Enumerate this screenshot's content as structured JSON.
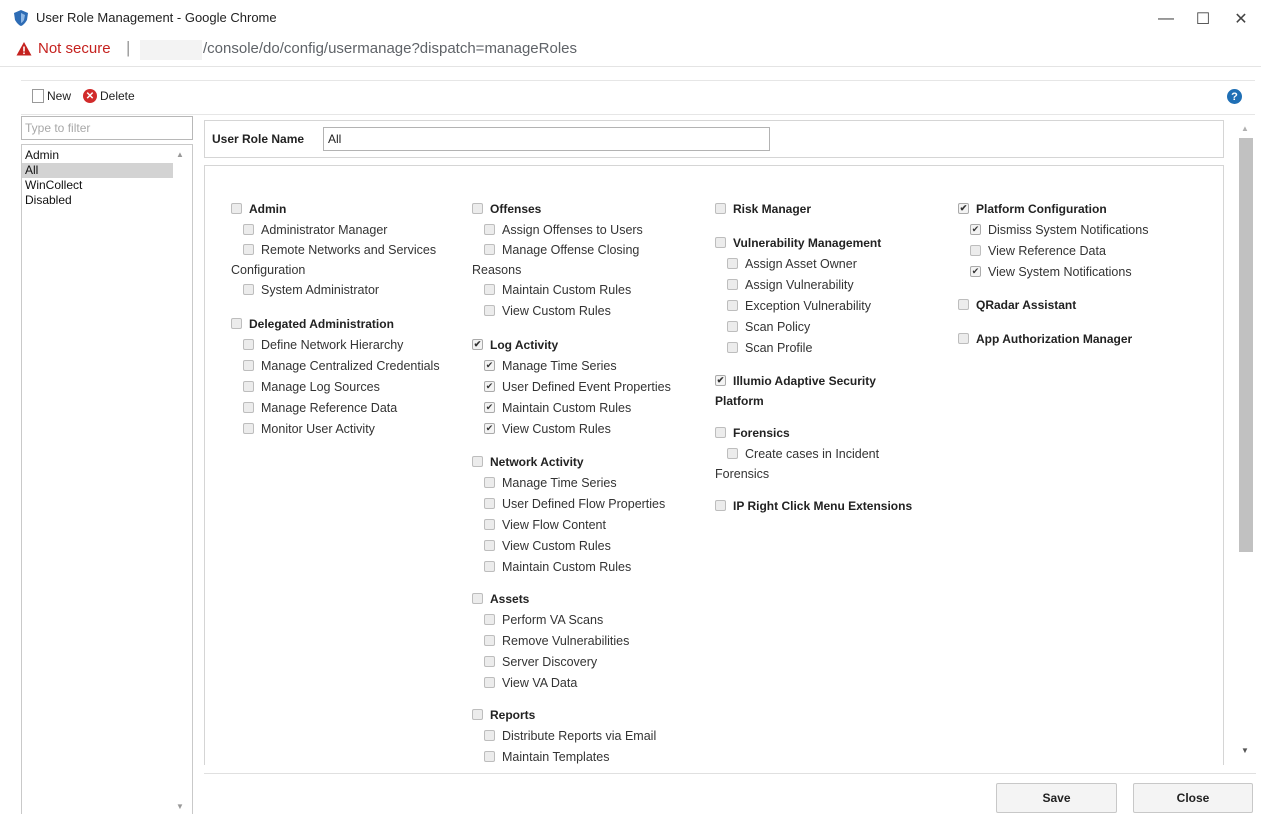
{
  "window": {
    "title": "User Role Management - Google Chrome",
    "minimize": "—",
    "maximize": "☐",
    "close": "✕"
  },
  "address": {
    "security": "Not secure",
    "separator": "|",
    "url": "/console/do/config/usermanage?dispatch=manageRoles"
  },
  "toolbar": {
    "new_label": "New",
    "delete_label": "Delete",
    "help": "?"
  },
  "filter": {
    "placeholder": "Type to filter"
  },
  "roles": {
    "items": [
      {
        "label": "Admin"
      },
      {
        "label": "All"
      },
      {
        "label": "WinCollect"
      },
      {
        "label": "Disabled"
      }
    ]
  },
  "role_name": {
    "label": "User Role Name",
    "value": "All"
  },
  "permissions": {
    "admin": {
      "title": "Admin",
      "items": [
        {
          "label": "Administrator Manager"
        },
        {
          "label": "Remote Networks and Services",
          "label2": "Configuration"
        },
        {
          "label": "System Administrator"
        }
      ]
    },
    "delegated": {
      "title": "Delegated Administration",
      "items": [
        {
          "label": "Define Network Hierarchy"
        },
        {
          "label": "Manage Centralized Credentials"
        },
        {
          "label": "Manage Log Sources"
        },
        {
          "label": "Manage Reference Data"
        },
        {
          "label": "Monitor User Activity"
        }
      ]
    },
    "offenses": {
      "title": "Offenses",
      "items": [
        {
          "label": "Assign Offenses to Users"
        },
        {
          "label": "Manage Offense Closing",
          "label2": "Reasons"
        },
        {
          "label": "Maintain Custom Rules"
        },
        {
          "label": "View Custom Rules"
        }
      ]
    },
    "log_activity": {
      "title": "Log Activity",
      "items": [
        {
          "label": "Manage Time Series"
        },
        {
          "label": "User Defined Event Properties"
        },
        {
          "label": "Maintain Custom Rules"
        },
        {
          "label": "View Custom Rules"
        }
      ]
    },
    "network_activity": {
      "title": "Network Activity",
      "items": [
        {
          "label": "Manage Time Series"
        },
        {
          "label": "User Defined Flow Properties"
        },
        {
          "label": "View Flow Content"
        },
        {
          "label": "View Custom Rules"
        },
        {
          "label": "Maintain Custom Rules"
        }
      ]
    },
    "assets": {
      "title": "Assets",
      "items": [
        {
          "label": "Perform VA Scans"
        },
        {
          "label": "Remove Vulnerabilities"
        },
        {
          "label": "Server Discovery"
        },
        {
          "label": "View VA Data"
        }
      ]
    },
    "reports": {
      "title": "Reports",
      "items": [
        {
          "label": "Distribute Reports via Email"
        },
        {
          "label": "Maintain Templates"
        }
      ]
    },
    "risk_manager": {
      "title": "Risk Manager"
    },
    "vulnerability": {
      "title": "Vulnerability Management",
      "items": [
        {
          "label": "Assign Asset Owner"
        },
        {
          "label": "Assign Vulnerability"
        },
        {
          "label": "Exception Vulnerability"
        },
        {
          "label": "Scan Policy"
        },
        {
          "label": "Scan Profile"
        }
      ]
    },
    "illumio": {
      "title": "Illumio Adaptive Security",
      "title2": "Platform"
    },
    "forensics": {
      "title": "Forensics",
      "items": [
        {
          "label": "Create cases in Incident",
          "label2": "Forensics"
        }
      ]
    },
    "ip_right_click": {
      "title": "IP Right Click Menu Extensions"
    },
    "platform_config": {
      "title": "Platform Configuration",
      "items": [
        {
          "label": "Dismiss System Notifications"
        },
        {
          "label": "View Reference Data"
        },
        {
          "label": "View System Notifications"
        }
      ]
    },
    "qradar_assistant": {
      "title": "QRadar Assistant"
    },
    "app_authorization": {
      "title": "App Authorization Manager"
    },
    "check_mark": "✔"
  },
  "footer": {
    "save_label": "Save",
    "close_label": "Close"
  }
}
